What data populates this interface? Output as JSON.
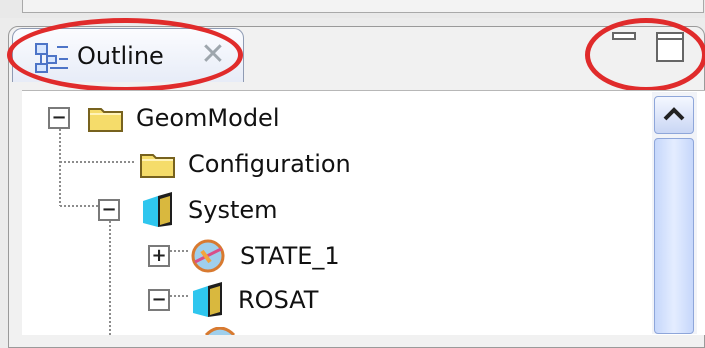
{
  "outline_view": {
    "tab_label": "Outline",
    "tree": [
      {
        "label": "GeomModel",
        "expander": "−",
        "icon": "folder-icon"
      },
      {
        "label": "Configuration",
        "expander": "",
        "icon": "folder-icon"
      },
      {
        "label": "System",
        "expander": "−",
        "icon": "system-icon"
      },
      {
        "label": "STATE_1",
        "expander": "+",
        "icon": "state-icon"
      },
      {
        "label": "ROSAT",
        "expander": "−",
        "icon": "system-icon"
      }
    ]
  },
  "colors": {
    "highlight": "#e02b2b",
    "tab_bg": "#e7ecf7",
    "scrollbar": "#c6d7fb",
    "folder": "#f5dc6a"
  }
}
